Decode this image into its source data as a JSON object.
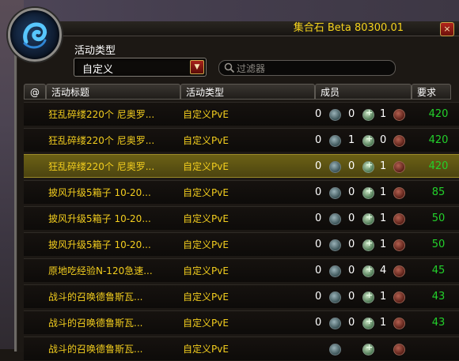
{
  "window": {
    "title": "集合石 Beta 80300.01",
    "close_label": "×"
  },
  "filters": {
    "activity_type_label": "活动类型",
    "activity_type_value": "自定义",
    "search_placeholder": "过滤器"
  },
  "columns": {
    "icon": "@",
    "title": "活动标题",
    "type": "活动类型",
    "members": "成员",
    "requirement": "要求"
  },
  "rows": [
    {
      "title": "狂乱碎缕220个 尼奥罗...",
      "type": "自定义PvE",
      "tank": "0",
      "heal": "0",
      "dps": "1",
      "req": "420"
    },
    {
      "title": "狂乱碎缕220个 尼奥罗...",
      "type": "自定义PvE",
      "tank": "0",
      "heal": "1",
      "dps": "0",
      "req": "420"
    },
    {
      "title": "狂乱碎缕220个 尼奥罗...",
      "type": "自定义PvE",
      "tank": "0",
      "heal": "0",
      "dps": "1",
      "req": "420"
    },
    {
      "title": "披风升级5箱子 10-20...",
      "type": "自定义PvE",
      "tank": "0",
      "heal": "0",
      "dps": "1",
      "req": "85"
    },
    {
      "title": "披风升级5箱子 10-20...",
      "type": "自定义PvE",
      "tank": "0",
      "heal": "0",
      "dps": "1",
      "req": "50"
    },
    {
      "title": "披风升级5箱子 10-20...",
      "type": "自定义PvE",
      "tank": "0",
      "heal": "0",
      "dps": "1",
      "req": "50"
    },
    {
      "title": "原地吃经验N-120急速...",
      "type": "自定义PvE",
      "tank": "0",
      "heal": "0",
      "dps": "4",
      "req": "45"
    },
    {
      "title": "战斗的召唤德鲁斯瓦...",
      "type": "自定义PvE",
      "tank": "0",
      "heal": "0",
      "dps": "1",
      "req": "43"
    },
    {
      "title": "战斗的召唤德鲁斯瓦...",
      "type": "自定义PvE",
      "tank": "0",
      "heal": "0",
      "dps": "1",
      "req": "43"
    },
    {
      "title": "战斗的召唤德鲁斯瓦...",
      "type": "自定义PvE",
      "tank": "",
      "heal": "",
      "dps": "",
      "req": ""
    }
  ],
  "selected_row_index": 2,
  "colors": {
    "accent_yellow": "#f2cd1e",
    "requirement_green": "#23d12b",
    "selected_row": "#6c6115"
  },
  "icons": {
    "portrait": "blue-swirl-icon",
    "search": "search-icon",
    "dropdown": "chevron-down-icon",
    "tank": "tank-role-icon",
    "heal": "healer-role-icon",
    "dps": "dps-role-icon"
  }
}
